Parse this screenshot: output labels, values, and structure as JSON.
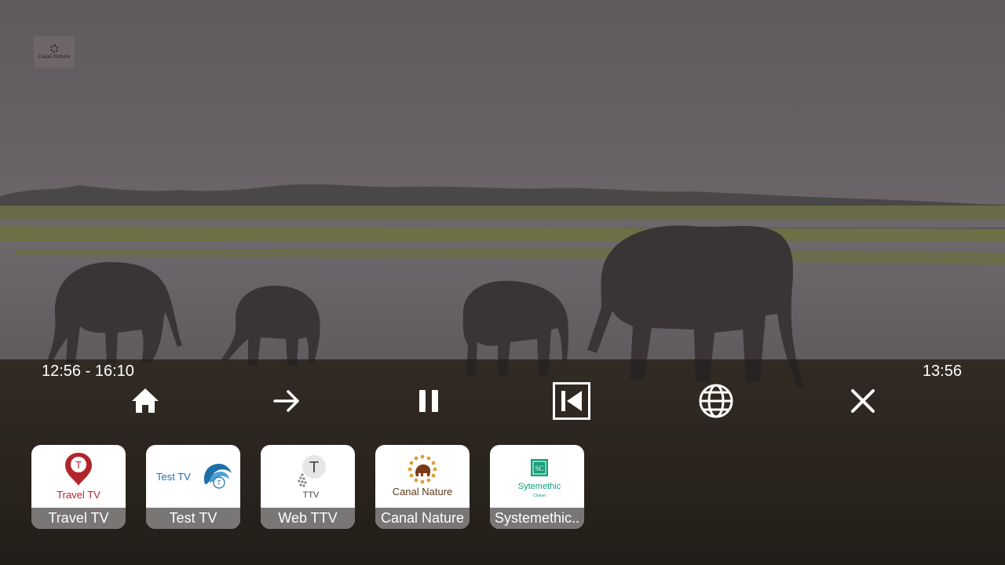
{
  "player": {
    "time_range": "12:56 - 16:10",
    "clock": "13:56",
    "watermark_text": "Canal Nature"
  },
  "controls": [
    {
      "name": "home-icon",
      "action": "home"
    },
    {
      "name": "arrow-right-icon",
      "action": "next"
    },
    {
      "name": "pause-icon",
      "action": "pause"
    },
    {
      "name": "skip-previous-icon",
      "action": "previous"
    },
    {
      "name": "globe-icon",
      "action": "web"
    },
    {
      "name": "close-icon",
      "action": "close"
    }
  ],
  "channels": [
    {
      "label": "Travel TV",
      "logo_text": "Travel TV",
      "logo_letter": "T",
      "color": "#b3242c"
    },
    {
      "label": "Test TV",
      "logo_text": "Test TV",
      "logo_letter": "T",
      "color": "#1e6fa8"
    },
    {
      "label": "Web TTV",
      "logo_text": "TTV",
      "logo_letter": "T",
      "color": "#555555"
    },
    {
      "label": "Canal Nature",
      "logo_text": "Canal Nature",
      "color": "#7a3c14"
    },
    {
      "label": "Systemethic..",
      "logo_text": "Sytemethic",
      "logo_letter": "SC",
      "logo_subtext": "Chanel",
      "color": "#13a07a"
    }
  ],
  "colors": {
    "overlay": "#141010",
    "label_bg": "#6e6a6a",
    "text": "#ffffff"
  }
}
